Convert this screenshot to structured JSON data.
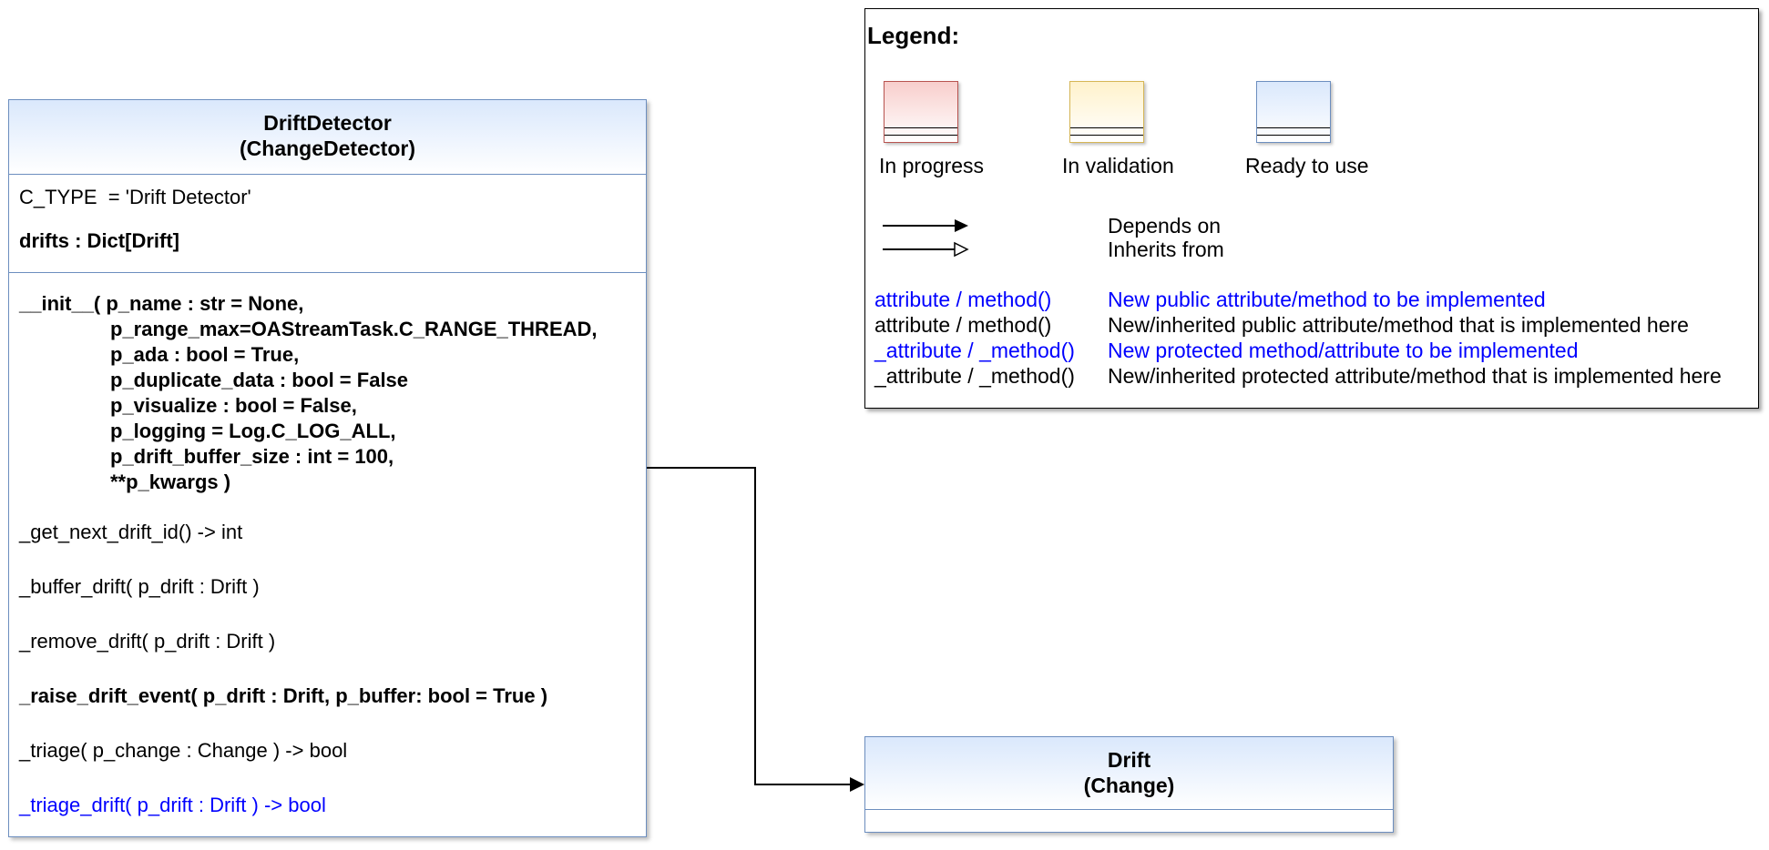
{
  "colors": {
    "uml_border": "#6c8ebf",
    "uml_header_fill": "#dae8fc",
    "in_progress_border": "#b85450",
    "in_progress_fill": "#f8cecc",
    "in_validation_border": "#d6b656",
    "in_validation_fill": "#fff2cc",
    "ready_border": "#6c8ebf",
    "ready_fill": "#dae8fc",
    "new_item_text": "#0000ff",
    "implemented_text": "#000000"
  },
  "drift_detector": {
    "name": "DriftDetector",
    "parent": "(ChangeDetector)",
    "attributes": [
      "C_TYPE  = 'Drift Detector'",
      "drifts : Dict[Drift]"
    ],
    "init_lines": [
      "__init__( p_name : str = None,",
      "p_range_max=OAStreamTask.C_RANGE_THREAD,",
      "p_ada : bool = True,",
      "p_duplicate_data : bool = False",
      "p_visualize : bool = False,",
      "p_logging = Log.C_LOG_ALL,",
      "p_drift_buffer_size : int = 100,",
      "**p_kwargs )"
    ],
    "methods": [
      "_get_next_drift_id() -> int",
      "_buffer_drift( p_drift : Drift )",
      "_remove_drift( p_drift : Drift )",
      "_raise_drift_event( p_drift : Drift, p_buffer: bool = True )",
      "_triage( p_change : Change ) -> bool",
      "_triage_drift( p_drift : Drift ) -> bool"
    ]
  },
  "drift": {
    "name": "Drift",
    "parent": "(Change)"
  },
  "legend": {
    "title": "Legend:",
    "statuses": [
      "In progress",
      "In validation",
      "Ready to use"
    ],
    "arrows": [
      "Depends on",
      "Inherits from"
    ],
    "notation": [
      {
        "sample": "attribute / method()",
        "meaning": "New public attribute/method to be implemented"
      },
      {
        "sample": "attribute / method()",
        "meaning": "New/inherited public attribute/method that is implemented here"
      },
      {
        "sample": "_attribute / _method()",
        "meaning": "New protected method/attribute to be implemented"
      },
      {
        "sample": "_attribute / _method()",
        "meaning": "New/inherited protected attribute/method that is implemented here"
      }
    ]
  }
}
